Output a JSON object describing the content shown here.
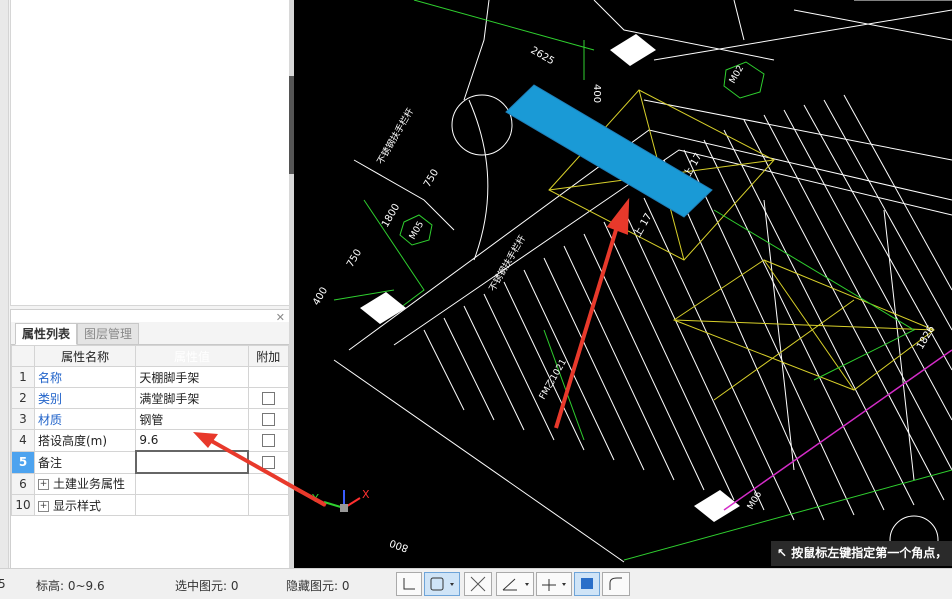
{
  "properties_panel": {
    "tabs": [
      "属性列表",
      "图层管理"
    ],
    "close_icon": "close-icon",
    "headers": {
      "name": "属性名称",
      "value": "属性值",
      "extra": "附加"
    },
    "rows": [
      {
        "index": "1",
        "name": "名称",
        "value": "天棚脚手架",
        "has_checkbox": false
      },
      {
        "index": "2",
        "name": "类别",
        "value": "满堂脚手架",
        "has_checkbox": true
      },
      {
        "index": "3",
        "name": "材质",
        "value": "钢管",
        "has_checkbox": true
      },
      {
        "index": "4",
        "name": "搭设高度(m)",
        "value": "9.6",
        "has_checkbox": true
      },
      {
        "index": "5",
        "name": "备注",
        "value": "",
        "has_checkbox": true
      },
      {
        "index": "6",
        "name": "土建业务属性",
        "value": "",
        "expandable": true
      },
      {
        "index": "10",
        "name": "显示样式",
        "value": "",
        "expandable": true
      }
    ]
  },
  "cad": {
    "dimensions": [
      "2625",
      "400",
      "750",
      "1800",
      "750",
      "400",
      "800",
      "1826"
    ],
    "door_tags": [
      "M02",
      "M05",
      "M06",
      "FM乙1021"
    ],
    "labels": [
      "不锈钢扶手栏杆",
      "不锈钢扶手栏杆",
      "上 17",
      "上 17",
      "M02"
    ],
    "command_hint": "按鼠标左键指定第一个角点，",
    "colors": {
      "background": "#000000",
      "highlight": "#1a9ad6",
      "arrow": "#e8392b"
    }
  },
  "statusbar": {
    "left_fragment": "5",
    "elevation": "标高:  0~9.6",
    "selected": "选中图元:  0",
    "hidden": "隐藏图元:  0"
  }
}
